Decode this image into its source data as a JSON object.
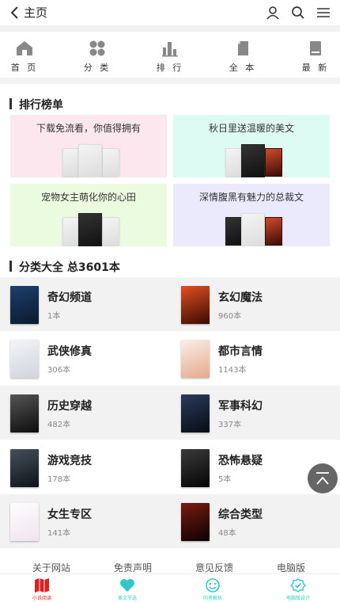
{
  "header": {
    "title": "主页",
    "back_icon": "chevron-left-icon",
    "user_icon": "user-icon",
    "search_icon": "search-icon",
    "menu_icon": "menu-icon"
  },
  "nav": [
    {
      "label": "首 页",
      "icon": "home-icon"
    },
    {
      "label": "分 类",
      "icon": "grid-icon"
    },
    {
      "label": "排 行",
      "icon": "bar-chart-icon"
    },
    {
      "label": "全 本",
      "icon": "book-icon"
    },
    {
      "label": "最 新",
      "icon": "new-book-icon"
    }
  ],
  "ranking": {
    "title": "排行榜单",
    "cards": [
      {
        "title": "下载免流看，你值得拥有",
        "bg": "#fde7ee"
      },
      {
        "title": "秋日里送温暖的美文",
        "bg": "#defbf3"
      },
      {
        "title": "宠物女主萌化你的心田",
        "bg": "#ebfbe0"
      },
      {
        "title": "深情腹黑有魅力的总裁文",
        "bg": "#ebeafc"
      }
    ]
  },
  "categories": {
    "title": "分类大全",
    "total": "总3601本",
    "items": [
      {
        "name": "奇幻频道",
        "count": "1本"
      },
      {
        "name": "玄幻魔法",
        "count": "960本"
      },
      {
        "name": "武侠修真",
        "count": "306本"
      },
      {
        "name": "都市言情",
        "count": "1143本"
      },
      {
        "name": "历史穿越",
        "count": "482本"
      },
      {
        "name": "军事科幻",
        "count": "337本"
      },
      {
        "name": "游戏竞技",
        "count": "178本"
      },
      {
        "name": "恐怖悬疑",
        "count": "5本"
      },
      {
        "name": "女生专区",
        "count": "141本"
      },
      {
        "name": "综合类型",
        "count": "48本"
      }
    ]
  },
  "footer_links": [
    "关于网站",
    "免责声明",
    "意见反馈",
    "电脑版"
  ],
  "tabs": [
    {
      "label": "小说阅读",
      "icon": "map-book-icon",
      "color": "#e02020"
    },
    {
      "label": "美文节选",
      "icon": "heart-icon",
      "color": "#30c8c8"
    },
    {
      "label": "问答解析",
      "icon": "smile-icon",
      "color": "#30c8c8"
    },
    {
      "label": "电脑版设计",
      "icon": "badge-check-icon",
      "color": "#30c8c8"
    }
  ],
  "colors": {
    "accent_red": "#e02020",
    "accent_teal": "#30c8c8",
    "stripe": "#f2f2f2"
  }
}
